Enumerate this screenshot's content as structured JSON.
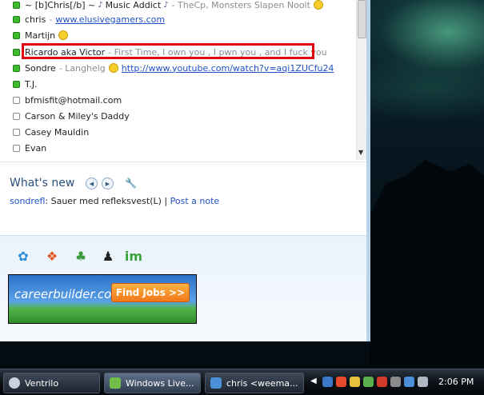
{
  "contacts": [
    {
      "name": "~ [b]Chris[/b] ~ ",
      "status": "online",
      "psm": "TheCp, Monsters Slapen Nooit",
      "prefix_note": "Music Addict",
      "emoticon": true
    },
    {
      "name": "chris",
      "status": "online",
      "link": "www.elusivegamers.com"
    },
    {
      "name": "Martijn",
      "status": "online",
      "emoticon": true
    },
    {
      "name": "Ricardo aka Victor",
      "status": "online",
      "psm": "First Time, I own you , I pwn you , and I fuck you",
      "highlighted": true
    },
    {
      "name": "Sondre",
      "status": "online",
      "psm": "Langhelg",
      "emoticon": true,
      "link": "http://www.youtube.com/watch?v=aqi1ZUCfu24"
    },
    {
      "name": "T.J.",
      "status": "online"
    },
    {
      "name": "bfmisfit@hotmail.com",
      "status": "offline"
    },
    {
      "name": "Carson & Miley's Daddy",
      "status": "offline"
    },
    {
      "name": "Casey Mauldin",
      "status": "offline"
    },
    {
      "name": "Evan",
      "status": "offline"
    }
  ],
  "whats_new": {
    "title": "What's new",
    "user": "sondrefl",
    "message": ": Sauer med refleksvest(L) | ",
    "post_note": "Post a note"
  },
  "ad": {
    "brand": "careerbuilder.com",
    "button": "Find Jobs >>"
  },
  "taskbar": {
    "items": [
      {
        "label": "Ventrilo",
        "active": false
      },
      {
        "label": "Windows Live...",
        "active": true
      },
      {
        "label": "chris <weema...",
        "active": false
      }
    ],
    "clock": "2:06 PM"
  },
  "colors": {
    "online": "#3dbb2d",
    "highlight": "#e00010",
    "link": "#1f52c4"
  }
}
